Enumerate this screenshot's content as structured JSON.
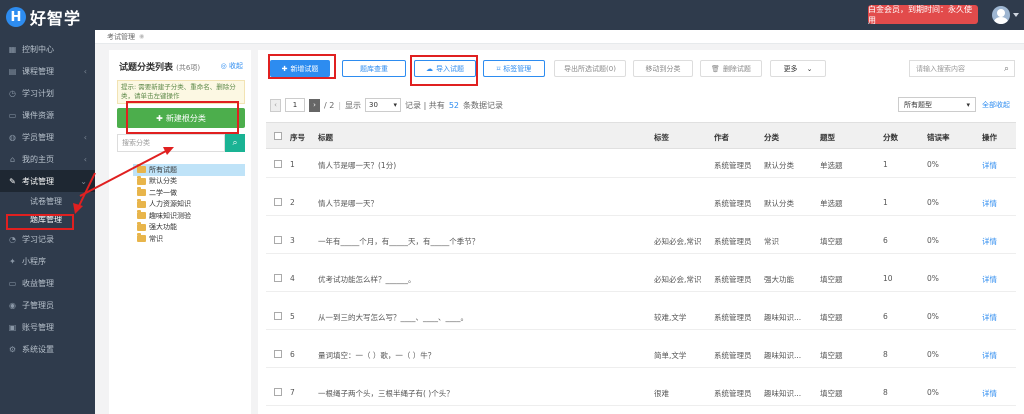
{
  "app": {
    "logo_badge": "H",
    "logo_text": "好智学",
    "vip_text": "白金会员，到期时间：永久使用"
  },
  "sidebar": {
    "items": [
      {
        "label": "控制中心",
        "icon": "dashboard-icon",
        "chevron": ""
      },
      {
        "label": "课程管理",
        "icon": "book-icon",
        "chevron": "‹"
      },
      {
        "label": "学习计划",
        "icon": "plan-icon",
        "chevron": ""
      },
      {
        "label": "课件资源",
        "icon": "folder-icon",
        "chevron": ""
      },
      {
        "label": "学员管理",
        "icon": "users-icon",
        "chevron": "‹"
      },
      {
        "label": "我的主页",
        "icon": "home-icon",
        "chevron": "‹"
      },
      {
        "label": "考试管理",
        "icon": "exam-icon",
        "chevron": "⌄"
      },
      {
        "label": "学习记录",
        "icon": "record-icon",
        "chevron": ""
      },
      {
        "label": "小程序",
        "icon": "miniapp-icon",
        "chevron": ""
      },
      {
        "label": "收益管理",
        "icon": "income-icon",
        "chevron": ""
      },
      {
        "label": "子管理员",
        "icon": "admin-icon",
        "chevron": ""
      },
      {
        "label": "账号管理",
        "icon": "account-icon",
        "chevron": ""
      },
      {
        "label": "系统设置",
        "icon": "settings-icon",
        "chevron": ""
      }
    ],
    "sub_items": [
      "试卷管理",
      "题库管理"
    ]
  },
  "breadcrumb": {
    "label": "考试管理",
    "close": "◉"
  },
  "left_panel": {
    "title": "试题分类列表",
    "count": "(共6项)",
    "collapse": "收起",
    "hint": "提示: 需要新建子分类、重命名、删除分类，请单击左键操作",
    "new_category": "新建根分类",
    "search_placeholder": "搜索分类",
    "tree": [
      "所有试题",
      "默认分类",
      "二学一做",
      "人力资源知识",
      "趣味知识测验",
      "强大功能",
      "常识"
    ]
  },
  "toolbar": {
    "add_question": "新增试题",
    "dedupe": "题库查重",
    "import": "导入试题",
    "tags": "标签管理",
    "export": "导出所选试题(0)",
    "move": "移动到分类",
    "delete": "删除试题",
    "more": "更多",
    "search_placeholder": "请输入搜索内容"
  },
  "pager": {
    "page": "1",
    "total_pages": "/ 2",
    "display_label": "显示",
    "page_size": "30",
    "records_prefix": "记录 | 共有",
    "total": "52",
    "records_suffix": "条数据记录",
    "type_filter": "所有题型",
    "expand_all": "全部收起"
  },
  "table": {
    "headers": [
      "序号",
      "标题",
      "标签",
      "作者",
      "分类",
      "题型",
      "分数",
      "错误率",
      "操作"
    ],
    "rows": [
      {
        "no": "1",
        "title": "情人节是哪一天？(1分)",
        "tags": "",
        "author": "系统管理员",
        "category": "默认分类",
        "type": "单选题",
        "score": "1",
        "error": "0%",
        "action": "详情"
      },
      {
        "no": "2",
        "title": "情人节是哪一天？",
        "tags": "",
        "author": "系统管理员",
        "category": "默认分类",
        "type": "单选题",
        "score": "1",
        "error": "0%",
        "action": "详情"
      },
      {
        "no": "3",
        "title": "一年有_____个月，有_____天，有_____个季节？",
        "tags": "必知必会,常识",
        "author": "系统管理员",
        "category": "常识",
        "type": "填空题",
        "score": "6",
        "error": "0%",
        "action": "详情"
      },
      {
        "no": "4",
        "title": "优考试功能怎么样？______。",
        "tags": "必知必会,常识",
        "author": "系统管理员",
        "category": "强大功能",
        "type": "填空题",
        "score": "10",
        "error": "0%",
        "action": "详情"
      },
      {
        "no": "5",
        "title": "从一到三的大写怎么写？____、____、____。",
        "tags": "较难,文学",
        "author": "系统管理员",
        "category": "趣味知识...",
        "type": "填空题",
        "score": "6",
        "error": "0%",
        "action": "详情"
      },
      {
        "no": "6",
        "title": "量词填空：一（ ）歌，一（ ）牛？",
        "tags": "简单,文学",
        "author": "系统管理员",
        "category": "趣味知识...",
        "type": "填空题",
        "score": "8",
        "error": "0%",
        "action": "详情"
      },
      {
        "no": "7",
        "title": "一根绳子两个头，三根半绳子有( )个头？",
        "tags": "很难",
        "author": "系统管理员",
        "category": "趣味知识...",
        "type": "填空题",
        "score": "8",
        "error": "0%",
        "action": "详情"
      }
    ]
  },
  "colors": {
    "topbar": "#2f3b4c",
    "primary": "#2d8cf0",
    "green": "#4cae4c",
    "teal": "#1ab394",
    "vip": "#e24b4b",
    "highlight": "#e02020"
  }
}
